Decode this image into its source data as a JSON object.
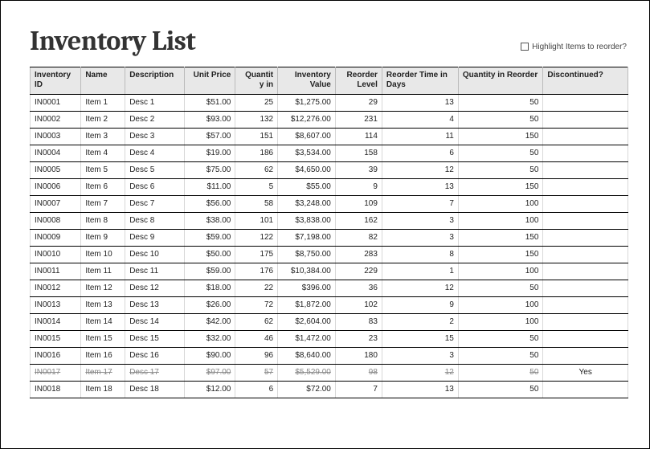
{
  "title": "Inventory List",
  "highlight_label": "Highlight Items to reorder?",
  "columns": {
    "id": "Inventory ID",
    "name": "Name",
    "desc": "Description",
    "price": "Unit Price",
    "qty": "Quantit y in",
    "value": "Inventory Value",
    "rlevel": "Reorder Level",
    "rtime": "Reorder Time in Days",
    "rqty": "Quantity in Reorder",
    "disc": "Discontinued?"
  },
  "rows": [
    {
      "id": "IN0001",
      "name": "Item 1",
      "desc": "Desc 1",
      "price": "$51.00",
      "qty": "25",
      "value": "$1,275.00",
      "rlevel": "29",
      "rtime": "13",
      "rqty": "50",
      "disc": ""
    },
    {
      "id": "IN0002",
      "name": "Item 2",
      "desc": "Desc 2",
      "price": "$93.00",
      "qty": "132",
      "value": "$12,276.00",
      "rlevel": "231",
      "rtime": "4",
      "rqty": "50",
      "disc": ""
    },
    {
      "id": "IN0003",
      "name": "Item 3",
      "desc": "Desc 3",
      "price": "$57.00",
      "qty": "151",
      "value": "$8,607.00",
      "rlevel": "114",
      "rtime": "11",
      "rqty": "150",
      "disc": ""
    },
    {
      "id": "IN0004",
      "name": "Item 4",
      "desc": "Desc 4",
      "price": "$19.00",
      "qty": "186",
      "value": "$3,534.00",
      "rlevel": "158",
      "rtime": "6",
      "rqty": "50",
      "disc": ""
    },
    {
      "id": "IN0005",
      "name": "Item 5",
      "desc": "Desc 5",
      "price": "$75.00",
      "qty": "62",
      "value": "$4,650.00",
      "rlevel": "39",
      "rtime": "12",
      "rqty": "50",
      "disc": ""
    },
    {
      "id": "IN0006",
      "name": "Item 6",
      "desc": "Desc 6",
      "price": "$11.00",
      "qty": "5",
      "value": "$55.00",
      "rlevel": "9",
      "rtime": "13",
      "rqty": "150",
      "disc": ""
    },
    {
      "id": "IN0007",
      "name": "Item 7",
      "desc": "Desc 7",
      "price": "$56.00",
      "qty": "58",
      "value": "$3,248.00",
      "rlevel": "109",
      "rtime": "7",
      "rqty": "100",
      "disc": ""
    },
    {
      "id": "IN0008",
      "name": "Item 8",
      "desc": "Desc 8",
      "price": "$38.00",
      "qty": "101",
      "value": "$3,838.00",
      "rlevel": "162",
      "rtime": "3",
      "rqty": "100",
      "disc": ""
    },
    {
      "id": "IN0009",
      "name": "Item 9",
      "desc": "Desc 9",
      "price": "$59.00",
      "qty": "122",
      "value": "$7,198.00",
      "rlevel": "82",
      "rtime": "3",
      "rqty": "150",
      "disc": ""
    },
    {
      "id": "IN0010",
      "name": "Item 10",
      "desc": "Desc 10",
      "price": "$50.00",
      "qty": "175",
      "value": "$8,750.00",
      "rlevel": "283",
      "rtime": "8",
      "rqty": "150",
      "disc": ""
    },
    {
      "id": "IN0011",
      "name": "Item 11",
      "desc": "Desc 11",
      "price": "$59.00",
      "qty": "176",
      "value": "$10,384.00",
      "rlevel": "229",
      "rtime": "1",
      "rqty": "100",
      "disc": ""
    },
    {
      "id": "IN0012",
      "name": "Item 12",
      "desc": "Desc 12",
      "price": "$18.00",
      "qty": "22",
      "value": "$396.00",
      "rlevel": "36",
      "rtime": "12",
      "rqty": "50",
      "disc": ""
    },
    {
      "id": "IN0013",
      "name": "Item 13",
      "desc": "Desc 13",
      "price": "$26.00",
      "qty": "72",
      "value": "$1,872.00",
      "rlevel": "102",
      "rtime": "9",
      "rqty": "100",
      "disc": ""
    },
    {
      "id": "IN0014",
      "name": "Item 14",
      "desc": "Desc 14",
      "price": "$42.00",
      "qty": "62",
      "value": "$2,604.00",
      "rlevel": "83",
      "rtime": "2",
      "rqty": "100",
      "disc": ""
    },
    {
      "id": "IN0015",
      "name": "Item 15",
      "desc": "Desc 15",
      "price": "$32.00",
      "qty": "46",
      "value": "$1,472.00",
      "rlevel": "23",
      "rtime": "15",
      "rqty": "50",
      "disc": ""
    },
    {
      "id": "IN0016",
      "name": "Item 16",
      "desc": "Desc 16",
      "price": "$90.00",
      "qty": "96",
      "value": "$8,640.00",
      "rlevel": "180",
      "rtime": "3",
      "rqty": "50",
      "disc": ""
    },
    {
      "id": "IN0017",
      "name": "Item 17",
      "desc": "Desc 17",
      "price": "$97.00",
      "qty": "57",
      "value": "$5,529.00",
      "rlevel": "98",
      "rtime": "12",
      "rqty": "50",
      "disc": "Yes",
      "discontinued": true
    },
    {
      "id": "IN0018",
      "name": "Item 18",
      "desc": "Desc 18",
      "price": "$12.00",
      "qty": "6",
      "value": "$72.00",
      "rlevel": "7",
      "rtime": "13",
      "rqty": "50",
      "disc": ""
    }
  ]
}
